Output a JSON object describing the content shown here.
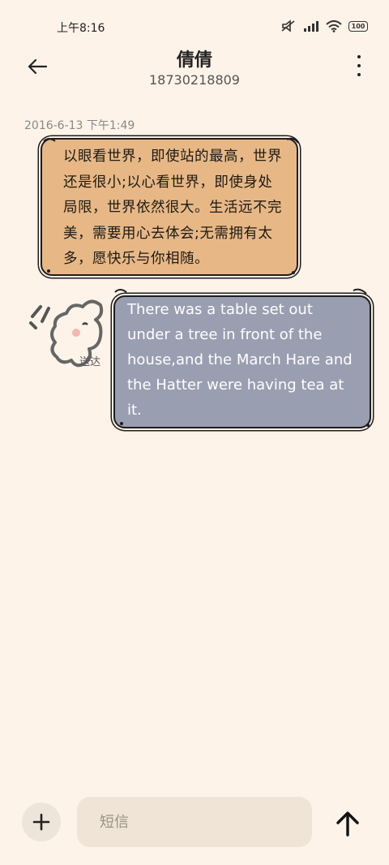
{
  "status_bar": {
    "time": "上午8:16",
    "battery": "100",
    "icons": [
      "mute-icon",
      "signal-icon",
      "wifi-icon",
      "battery-icon"
    ]
  },
  "header": {
    "contact_name": "倩倩",
    "phone_number": "18730218809",
    "back_icon": "back-arrow-icon",
    "more_icon": "more-vertical-icon"
  },
  "conversation": {
    "timestamp": "2016-6-13 下午1:49",
    "messages": [
      {
        "direction": "incoming",
        "text": "以眼看世界，即使站的最高，世界还是很小;以心看世界，即使身处局限，世界依然很大。生活远不完美，需要用心去体会;无需拥有太多，愿快乐与你相随。"
      },
      {
        "direction": "outgoing",
        "text": "There was a table set out under a tree in front of the house,and the March Hare and the Hatter were having tea at it.",
        "status": "送达"
      }
    ]
  },
  "composer": {
    "placeholder": "短信",
    "add_icon": "plus-icon",
    "send_icon": "send-arrow-icon"
  },
  "colors": {
    "background": "#fdf3e9",
    "incoming_bubble": "#e7b886",
    "outgoing_bubble": "#999eb1"
  }
}
